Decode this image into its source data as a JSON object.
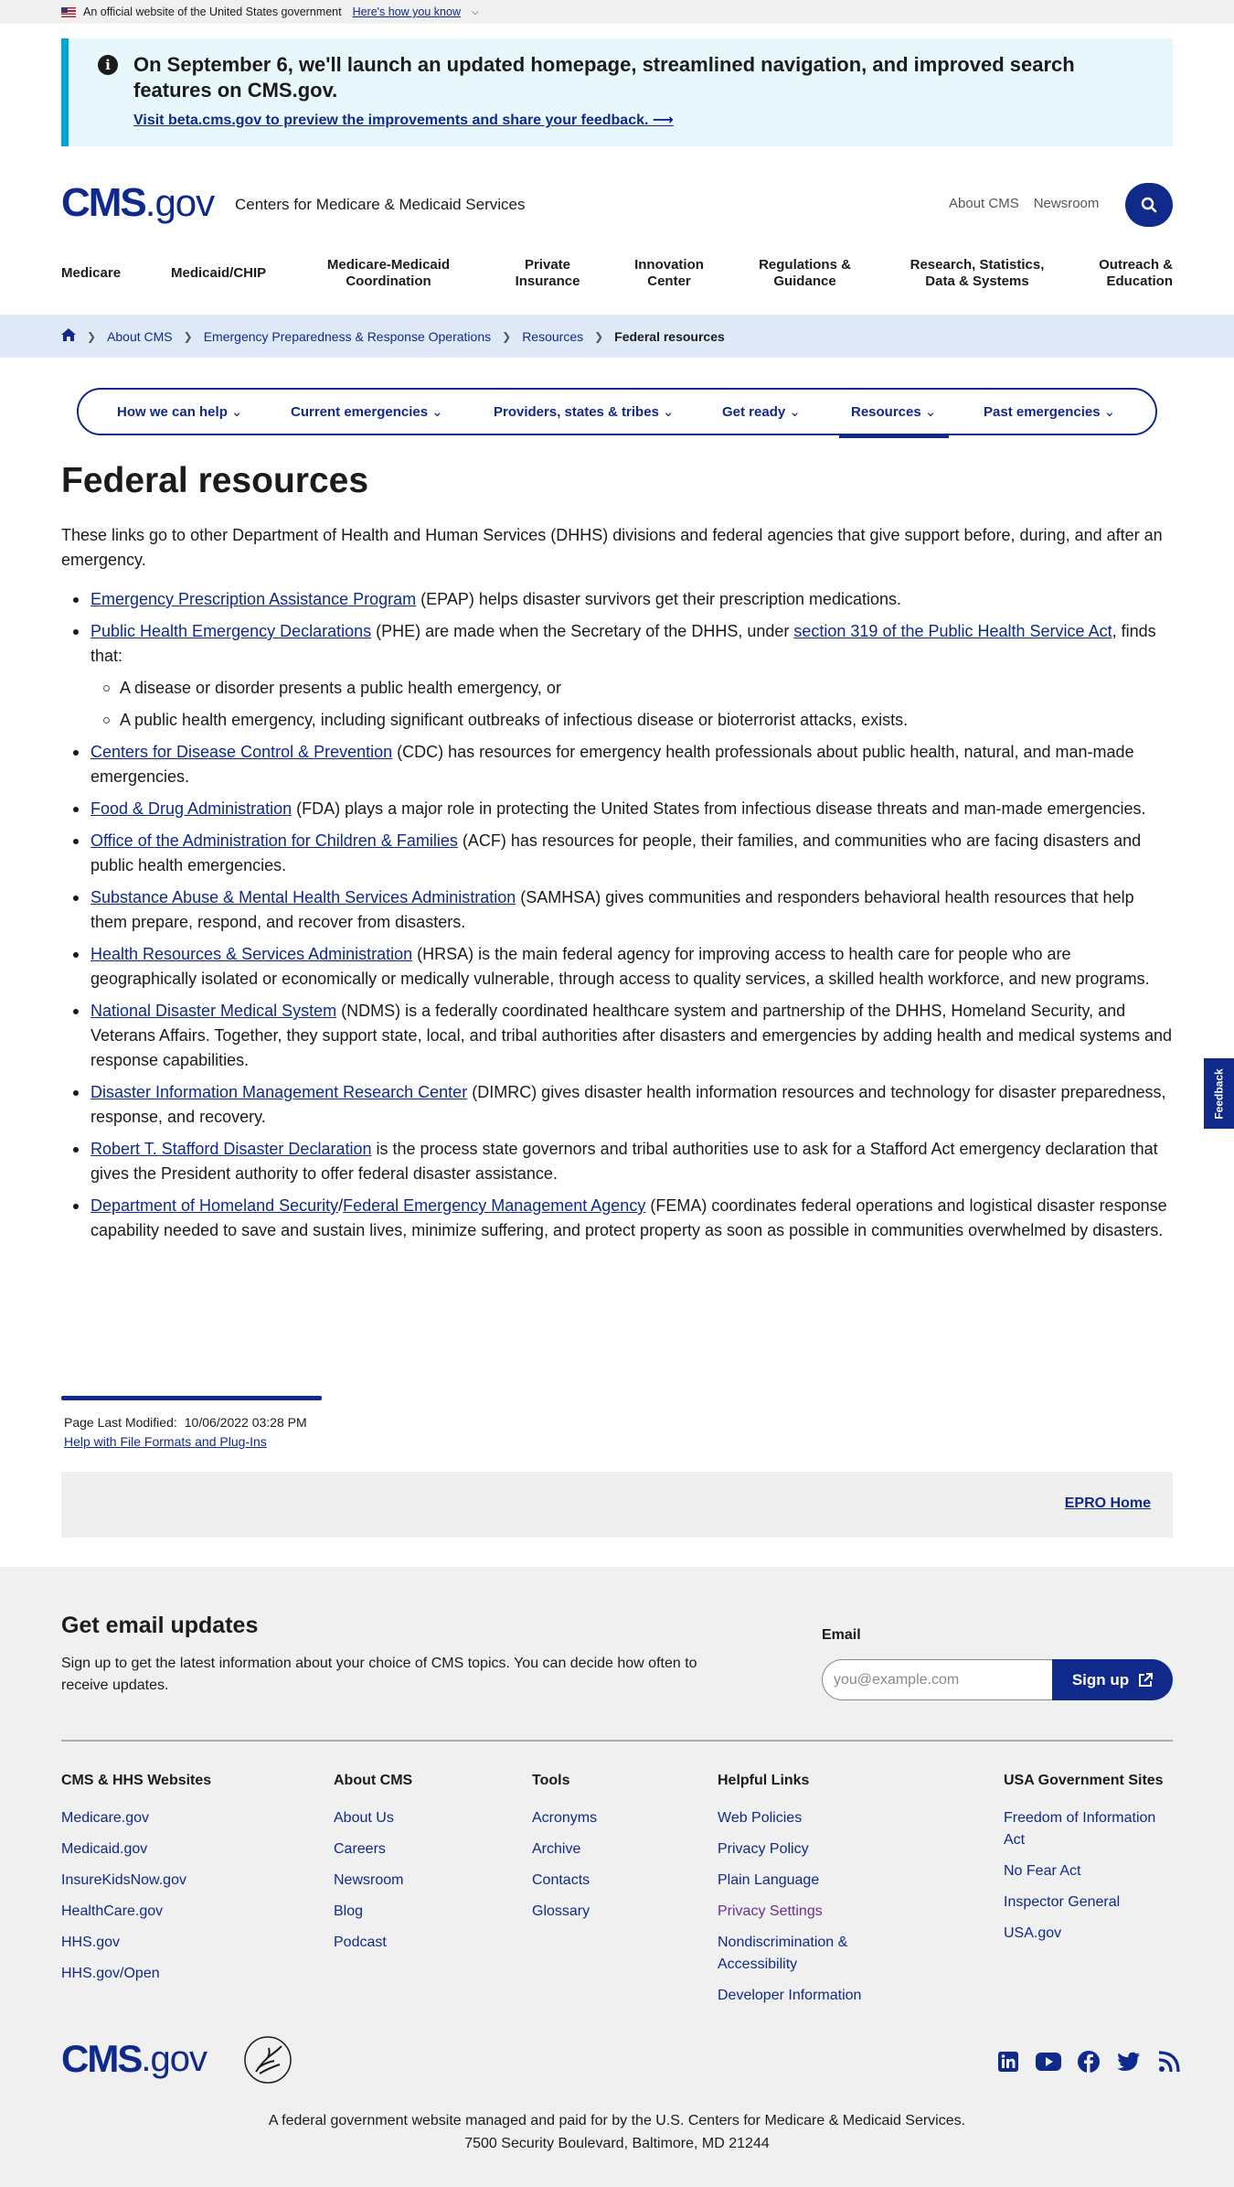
{
  "gov_banner": {
    "text": "An official website of the United States government",
    "link": "Here's how you know"
  },
  "alert": {
    "heading": "On September 6, we'll launch an updated homepage, streamlined navigation, and improved search features on CMS.gov.",
    "link": "Visit beta.cms.gov to preview the improvements and share your feedback."
  },
  "header": {
    "logo_cms": "CMS",
    "logo_gov": ".gov",
    "agency_name": "Centers for Medicare & Medicaid Services",
    "util_links": [
      "About CMS",
      "Newsroom"
    ]
  },
  "main_nav": [
    "Medicare",
    "Medicaid/CHIP",
    "Medicare-Medicaid Coordination",
    "Private Insurance",
    "Innovation Center",
    "Regulations & Guidance",
    "Research, Statistics, Data & Systems",
    "Outreach & Education"
  ],
  "breadcrumbs": [
    "About CMS",
    "Emergency Preparedness & Response Operations",
    "Resources"
  ],
  "breadcrumb_current": "Federal resources",
  "subnav": [
    "How we can help",
    "Current emergencies",
    "Providers, states & tribes",
    "Get ready",
    "Resources",
    "Past emergencies"
  ],
  "page": {
    "title": "Federal resources",
    "intro": "These links go to other Department of Health and Human Services (DHHS) divisions and federal agencies that give support before, during, and after an emergency.",
    "items": [
      {
        "link": "Emergency Prescription Assistance Program",
        "text": " (EPAP) helps disaster survivors get their prescription medications."
      },
      {
        "link": "Public Health Emergency Declarations",
        "text": " (PHE) are made when the Secretary of the DHHS, under ",
        "link2": "section 319 of the Public Health Service Act",
        "text2": ", finds that:",
        "sub": [
          "A disease or disorder presents a public health emergency, or",
          "A public health emergency, including significant outbreaks of infectious disease or bioterrorist attacks, exists."
        ]
      },
      {
        "link": "Centers for Disease Control & Prevention",
        "text": " (CDC) has resources for emergency health professionals about public health, natural, and man-made emergencies."
      },
      {
        "link": "Food & Drug Administration",
        "text": " (FDA) plays a major role in protecting the United States from infectious disease threats and man-made emergencies."
      },
      {
        "link": "Office of the Administration for Children & Families",
        "text": " (ACF) has resources for people, their families, and communities who are facing disasters and public health emergencies."
      },
      {
        "link": "Substance Abuse & Mental Health Services Administration",
        "text": " (SAMHSA) gives communities and responders behavioral health resources that help them prepare, respond, and recover from disasters."
      },
      {
        "link": "Health Resources & Services Administration",
        "text": " (HRSA) is the main federal agency for improving access to health care for people who are geographically isolated or economically or medically vulnerable, through access to quality services, a skilled health workforce, and new programs."
      },
      {
        "link": "National Disaster Medical System",
        "text": " (NDMS) is a federally coordinated healthcare system and partnership of the DHHS, Homeland Security, and Veterans Affairs. Together, they support state, local, and tribal authorities after disasters and emergencies by adding health and medical systems and response capabilities."
      },
      {
        "link": "Disaster Information Management Research Center",
        "text": " (DIMRC) gives disaster health information resources and technology for disaster preparedness, response, and recovery."
      },
      {
        "link": "Robert T. Stafford Disaster Declaration",
        "text": " is the process state governors and tribal authorities use to ask for a Stafford Act emergency declaration that gives the President authority to offer federal disaster assistance."
      },
      {
        "link": "Department of Homeland Security",
        "text": "/",
        "link2": "Federal Emergency Management Agency",
        "text2": " (FEMA) coordinates federal operations and logistical disaster response capability needed to save and sustain lives, minimize suffering, and protect property as soon as possible in communities overwhelmed by disasters."
      }
    ],
    "last_modified_label": "Page Last Modified:",
    "last_modified": "10/06/2022 03:28 PM",
    "help_link": "Help with File Formats and Plug-Ins",
    "epro_link": "EPRO Home"
  },
  "footer": {
    "email_heading": "Get email updates",
    "email_text": "Sign up to get the latest information about your choice of CMS topics. You can decide how often to receive updates.",
    "email_label": "Email",
    "email_placeholder": "you@example.com",
    "signup_label": "Sign up",
    "columns": [
      {
        "title": "CMS & HHS Websites",
        "links": [
          "Medicare.gov",
          "Medicaid.gov",
          "InsureKidsNow.gov",
          "HealthCare.gov",
          "HHS.gov",
          "HHS.gov/Open"
        ]
      },
      {
        "title": "About CMS",
        "links": [
          "About Us",
          "Careers",
          "Newsroom",
          "Blog",
          "Podcast"
        ]
      },
      {
        "title": "Tools",
        "links": [
          "Acronyms",
          "Archive",
          "Contacts",
          "Glossary"
        ]
      },
      {
        "title": "Helpful Links",
        "links": [
          "Web Policies",
          "Privacy Policy",
          "Plain Language",
          "Privacy Settings",
          "Nondiscrimination & Accessibility",
          "Developer Information"
        ]
      },
      {
        "title": "USA Government Sites",
        "links": [
          "Freedom of Information Act",
          "No Fear Act",
          "Inspector General",
          "USA.gov"
        ]
      }
    ],
    "legal_line1": "A federal government website managed and paid for by the U.S. Centers for Medicare & Medicaid Services.",
    "legal_line2": "7500 Security Boulevard, Baltimore, MD 21244",
    "social_icons": [
      "linkedin-icon",
      "youtube-icon",
      "facebook-icon",
      "twitter-icon",
      "rss-icon"
    ]
  },
  "feedback_label": "Feedback",
  "colors": {
    "primary": "#0f2a8a",
    "alert_bg": "#e7f7fb",
    "alert_border": "#00a7d4",
    "breadcrumb_bg": "#dfe8f7",
    "footer_bg": "#f0f0f0",
    "visited": "#6f2e8f"
  }
}
